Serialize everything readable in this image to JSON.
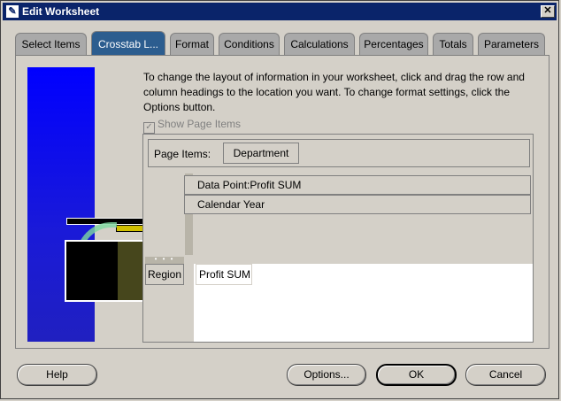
{
  "window": {
    "title": "Edit Worksheet",
    "close_glyph": "✕"
  },
  "tabs": [
    {
      "label": "Select Items",
      "active": false
    },
    {
      "label": "Crosstab L...",
      "active": true
    },
    {
      "label": "Format",
      "active": false
    },
    {
      "label": "Conditions",
      "active": false
    },
    {
      "label": "Calculations",
      "active": false
    },
    {
      "label": "Percentages",
      "active": false
    },
    {
      "label": "Totals",
      "active": false
    },
    {
      "label": "Parameters",
      "active": false
    }
  ],
  "description": "To change the layout of information in your worksheet, click and drag the row and column headings to the location you want.  To change format settings, click the Options button.",
  "show_page_items": {
    "label": "Show Page Items",
    "checked": true,
    "enabled": false
  },
  "layout": {
    "page_items_label": "Page Items:",
    "page_items": [
      "Department"
    ],
    "column_headers": [
      "Data Point:Profit SUM",
      "Calendar Year"
    ],
    "row_headers": [
      "Region"
    ],
    "data_header": "Profit SUM"
  },
  "buttons": {
    "help": "Help",
    "options": "Options...",
    "ok": "OK",
    "cancel": "Cancel"
  },
  "colors": {
    "title_bar": "#0a246a",
    "active_tab": "#2c5d8f",
    "inactive_tab": "#a9a9a9",
    "dialog_bg": "#d4d0c8"
  }
}
